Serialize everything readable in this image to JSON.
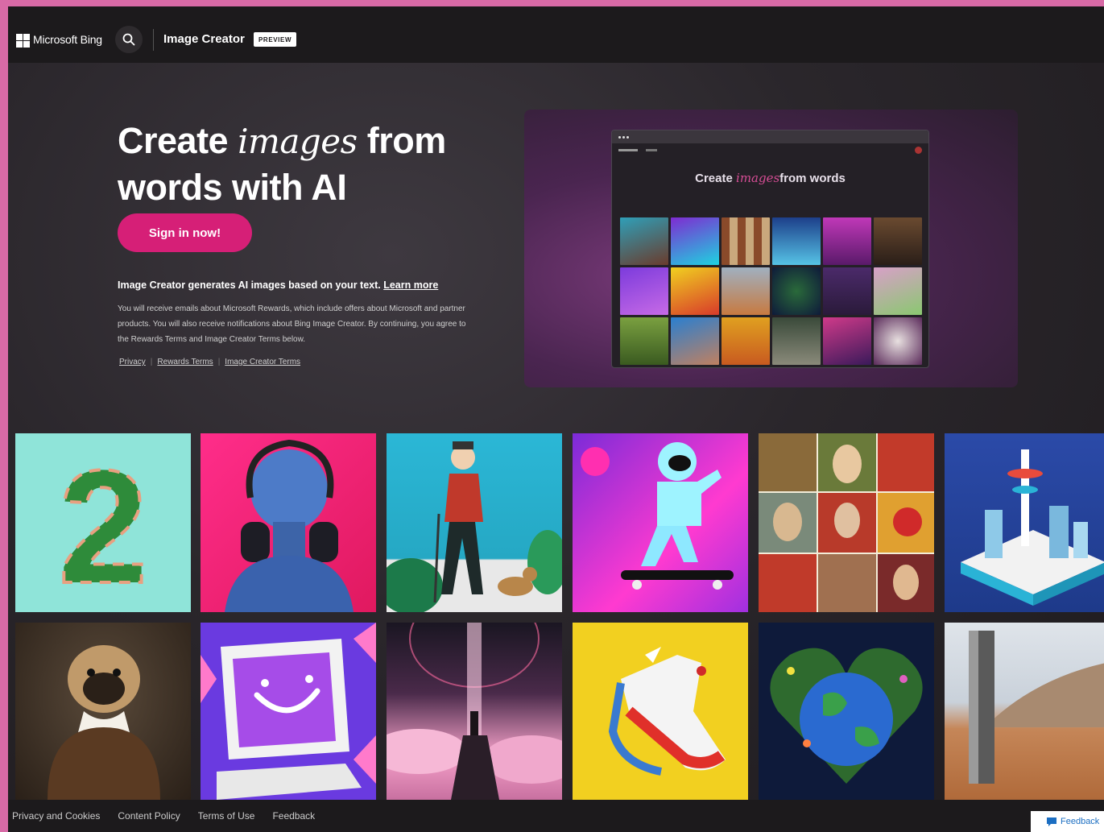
{
  "header": {
    "brand": "Microsoft Bing",
    "app_title": "Image Creator",
    "badge": "PREVIEW"
  },
  "hero": {
    "title_line1_a": "Create",
    "title_line1_em": "images",
    "title_line1_b": "from",
    "title_line2": "words with AI",
    "signin_label": "Sign in now!",
    "desc_text": "Image Creator generates AI images based on your text.",
    "learn_more": "Learn more",
    "fine_print": "You will receive emails about Microsoft Rewards, which include offers about Microsoft and partner products. You will also receive notifications about Bing Image Creator. By continuing, you agree to the Rewards Terms and Image Creator Terms below.",
    "links": [
      "Privacy",
      "Rewards Terms",
      "Image Creator Terms"
    ]
  },
  "mock": {
    "title_a": "Create",
    "title_em": "images",
    "title_b": "from words"
  },
  "footer": {
    "links": [
      "Privacy and Cookies",
      "Content Policy",
      "Terms of Use",
      "Feedback"
    ],
    "feedback_button": "Feedback"
  },
  "colors": {
    "accent": "#d61f77",
    "page_border": "#d86aa6",
    "topbar": "#1c1a1c"
  },
  "icons": [
    "microsoft-logo-icon",
    "search-icon",
    "feedback-icon"
  ]
}
